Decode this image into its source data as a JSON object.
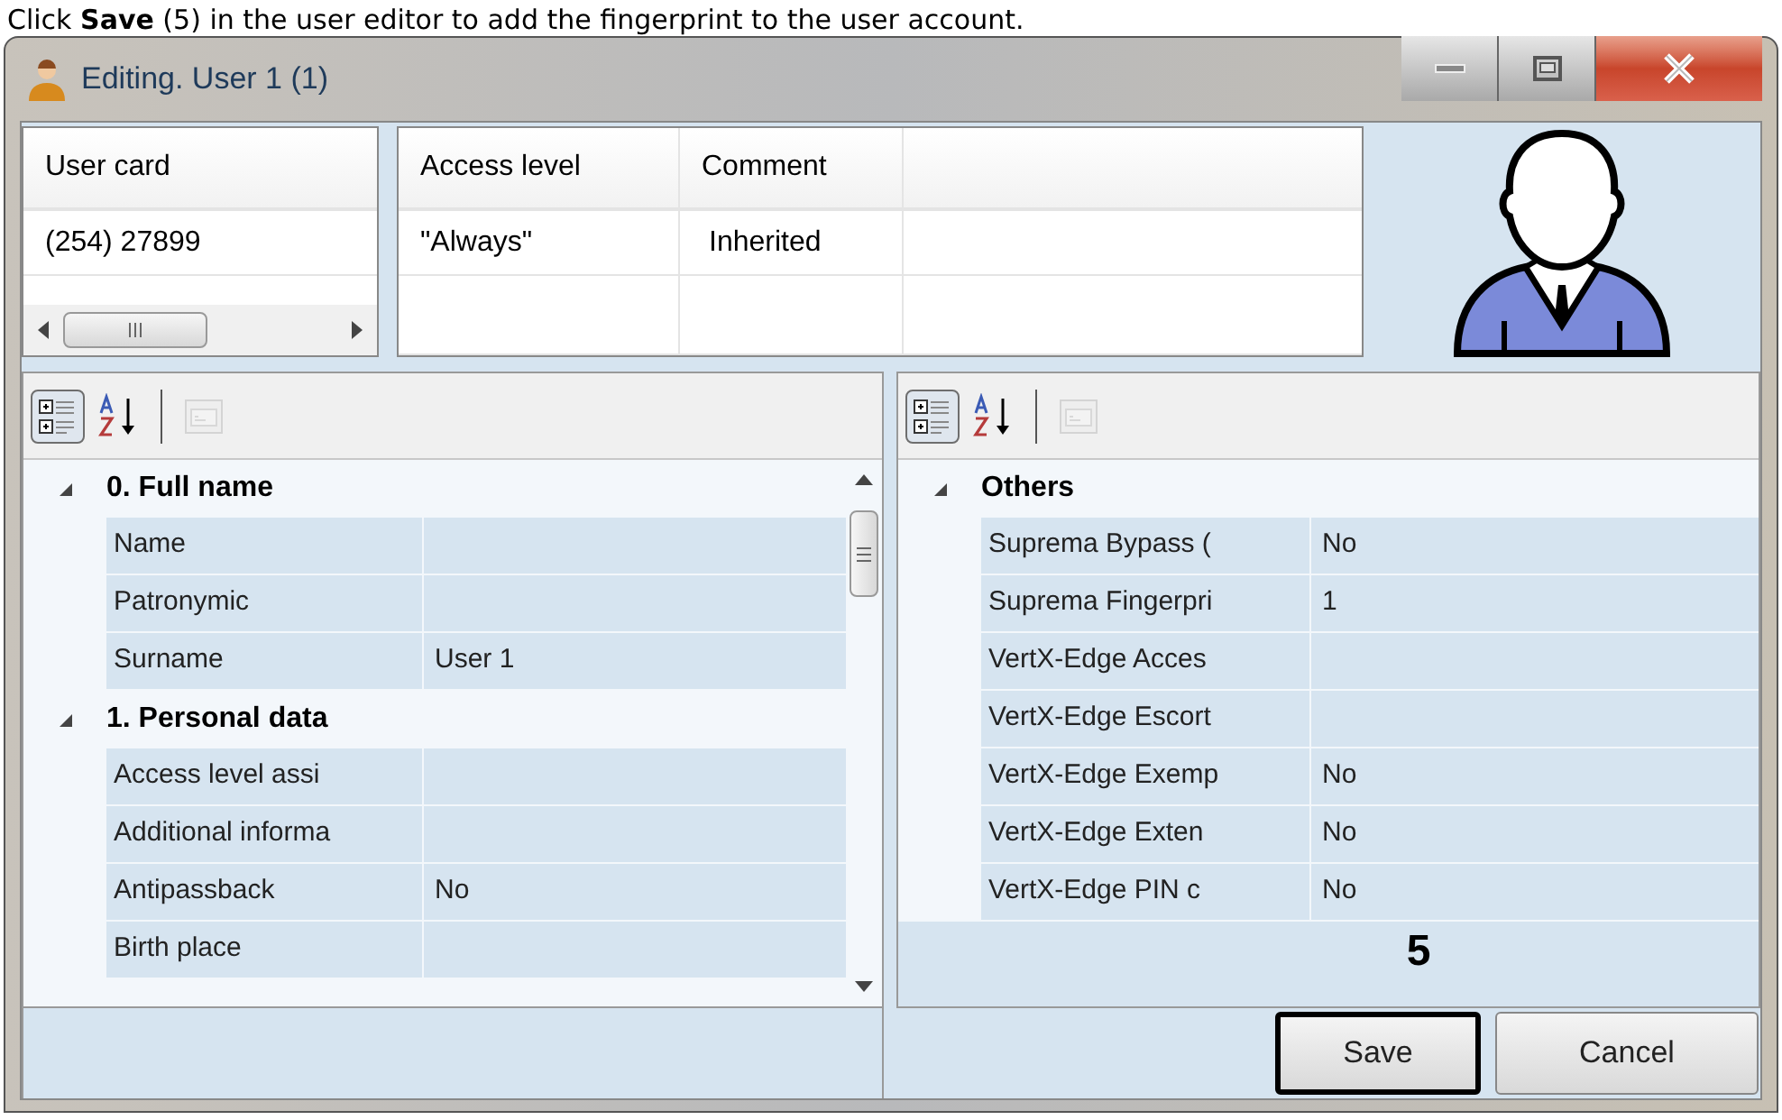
{
  "caption": "Click **Save** (5) in the user editor to add the fingerprint to the user account.",
  "window": {
    "title": "Editing. User 1 (1)"
  },
  "card_list": {
    "column": "User card",
    "rows": [
      "(254) 27899"
    ]
  },
  "access_table": {
    "columns": [
      "Access level",
      "Comment"
    ],
    "rows": [
      [
        "\"Always\"",
        "Inherited"
      ]
    ]
  },
  "left_grid": {
    "toolbar": [
      {
        "kind": "categorized",
        "selected": true,
        "disabled": false
      },
      {
        "kind": "alphabetical",
        "selected": false,
        "disabled": false
      },
      {
        "kind": "pages",
        "selected": false,
        "disabled": true
      }
    ],
    "sections": [
      {
        "title": "0. Full name",
        "expanded": true,
        "rows": [
          {
            "label": "Name",
            "value": ""
          },
          {
            "label": "Patronymic",
            "value": ""
          },
          {
            "label": "Surname",
            "value": "User 1"
          }
        ]
      },
      {
        "title": "1. Personal data",
        "expanded": true,
        "rows": [
          {
            "label": "Access level assi",
            "value": ""
          },
          {
            "label": "Additional informa",
            "value": ""
          },
          {
            "label": "Antipassback",
            "value": "No"
          },
          {
            "label": "Birth place",
            "value": ""
          }
        ]
      }
    ]
  },
  "right_grid": {
    "toolbar": [
      {
        "kind": "categorized",
        "selected": true,
        "disabled": false
      },
      {
        "kind": "alphabetical",
        "selected": false,
        "disabled": false
      },
      {
        "kind": "pages",
        "selected": false,
        "disabled": true
      }
    ],
    "sections": [
      {
        "title": "Others",
        "expanded": true,
        "rows": [
          {
            "label": "Suprema Bypass (",
            "value": "No"
          },
          {
            "label": "Suprema Fingerpri",
            "value": "1"
          },
          {
            "label": "VertX-Edge Acces",
            "value": ""
          },
          {
            "label": "VertX-Edge Escort",
            "value": ""
          },
          {
            "label": "VertX-Edge Exemp",
            "value": "No"
          },
          {
            "label": "VertX-Edge Exten",
            "value": "No"
          },
          {
            "label": "VertX-Edge PIN c",
            "value": "No"
          }
        ]
      }
    ]
  },
  "callout": "5",
  "buttons": [
    {
      "label": "Save",
      "selected": true
    },
    {
      "label": "Cancel",
      "selected": false
    }
  ]
}
